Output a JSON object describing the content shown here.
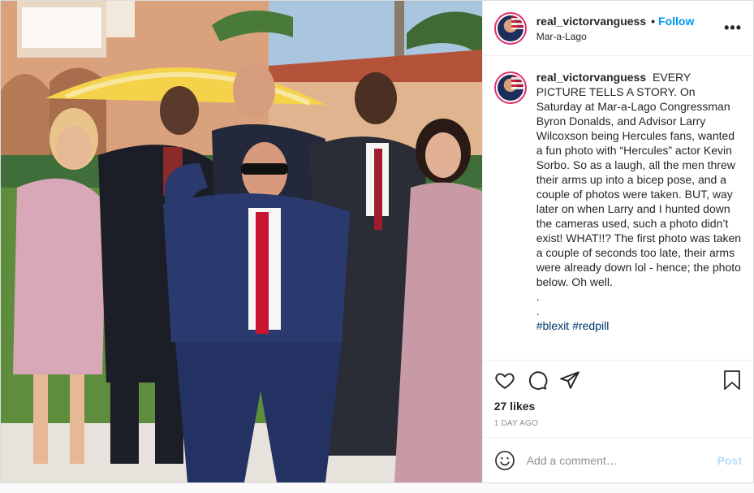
{
  "post": {
    "username": "real_victorvanguess",
    "separator": "•",
    "follow_label": "Follow",
    "location": "Mar-a-Lago",
    "more_label": "•••"
  },
  "caption": {
    "username": "real_victorvanguess",
    "text": "EVERY PICTURE TELLS A STORY. On Saturday at Mar-a-Lago Congressman Byron Donalds, and Advisor Larry Wilcoxson being Hercules fans, wanted a fun photo with “Hercules” actor Kevin Sorbo. So as a laugh, all the men threw their arms up into a bicep pose, and a couple of photos were taken. BUT, way later on when Larry and I hunted down the cameras used, such a photo didn’t exist! WHAT!!? The first photo was taken a couple of seconds too late, their arms were already down lol - hence; the photo below. Oh well.",
    "dot1": ".",
    "dot2": ".",
    "hashtags": [
      "#blexit",
      "#redpill"
    ]
  },
  "actions": {
    "icons": [
      "heart-icon",
      "comment-icon",
      "share-icon",
      "bookmark-icon"
    ],
    "likes": "27 likes",
    "time_ago": "1 DAY AGO"
  },
  "comment_box": {
    "placeholder": "Add a comment…",
    "post_label": "Post"
  },
  "colors": {
    "follow": "#0095f6",
    "post_disabled": "#b2dffc",
    "hashtag": "#00376b",
    "story_ring": "#e1306c"
  }
}
